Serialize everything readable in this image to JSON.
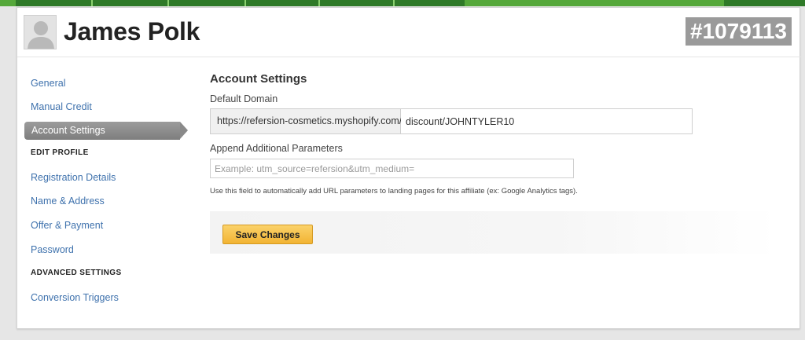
{
  "header": {
    "affiliate_name": "James Polk",
    "affiliate_id": "#1079113"
  },
  "sidebar": {
    "items": [
      {
        "label": "General"
      },
      {
        "label": "Manual Credit"
      },
      {
        "label": "Account Settings",
        "active": true
      }
    ],
    "edit_profile_heading": "EDIT PROFILE",
    "edit_profile_items": [
      {
        "label": "Registration Details"
      },
      {
        "label": "Name & Address"
      },
      {
        "label": "Offer & Payment"
      },
      {
        "label": "Password"
      }
    ],
    "advanced_heading": "ADVANCED SETTINGS",
    "advanced_items": [
      {
        "label": "Conversion Triggers"
      }
    ]
  },
  "main": {
    "section_title": "Account Settings",
    "default_domain_label": "Default Domain",
    "domain_prefix": "https://refersion-cosmetics.myshopify.com/",
    "domain_value": "discount/JOHNTYLER10",
    "append_params_label": "Append Additional Parameters",
    "append_params_placeholder": "Example: utm_source=refersion&utm_medium=",
    "append_params_value": "",
    "help_text": "Use this field to automatically add URL parameters to landing pages for this affiliate (ex: Google Analytics tags).",
    "save_label": "Save Changes"
  },
  "colors": {
    "nav_green": "#55a83a",
    "link_blue": "#3f72ad",
    "save_button": "#f2b433",
    "id_badge": "#9a9a9a"
  },
  "icons": {
    "avatar": "user-silhouette-icon"
  }
}
